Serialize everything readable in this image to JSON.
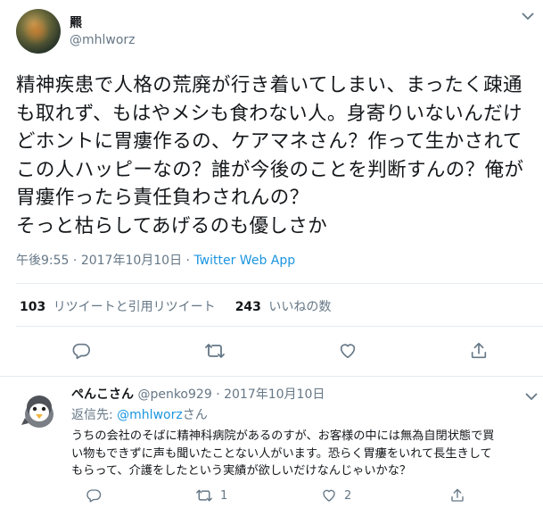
{
  "author": {
    "display_name": "羆",
    "handle": "@mhlworz"
  },
  "tweet": {
    "text": "精神疾患で人格の荒廃が行き着いてしまい、まったく疎通\nも取れず、もはやメシも食わない人。身寄りいないんだけ\nどホントに胃瘻作るの、ケアマネさん？作って生かされて\nこの人ハッピーなの？誰が今後のことを判断すんの？俺が\n胃瘻作ったら責任負わされんの？\nそっと枯らしてあげるのも優しさか",
    "time": "午後9:55",
    "date": "2017年10月10日",
    "separator": "·",
    "source": "Twitter Web App"
  },
  "stats": {
    "retweets_count": "103",
    "retweets_label": "リツイートと引用リツイート",
    "likes_count": "243",
    "likes_label": "いいねの数"
  },
  "icons": {
    "reply": "reply-icon",
    "retweet": "retweet-icon",
    "like": "heart-icon",
    "share": "share-icon",
    "more": "chevron-down-icon"
  },
  "reply": {
    "display_name": "ぺんこさん",
    "handle": "@penko929",
    "separator": "·",
    "date": "2017年10月10日",
    "replying_prefix": "返信先: ",
    "replying_to": "@mhlworz",
    "replying_suffix": "さん",
    "text": "うちの会社のそばに精神科病院があるのすが、お客様の中には無為自閉状態で買\nい物もできずに声も聞いたことない人がいます。恐らく胃瘻をいれて長生きして\nもらって、介護をしたという実績が欲しいだけなんじゃいかな？",
    "retweet_count": "1",
    "like_count": "2"
  },
  "colors": {
    "text": "#14171a",
    "secondary": "#657786",
    "link": "#1b95e0",
    "divider": "#e6ecf0"
  }
}
